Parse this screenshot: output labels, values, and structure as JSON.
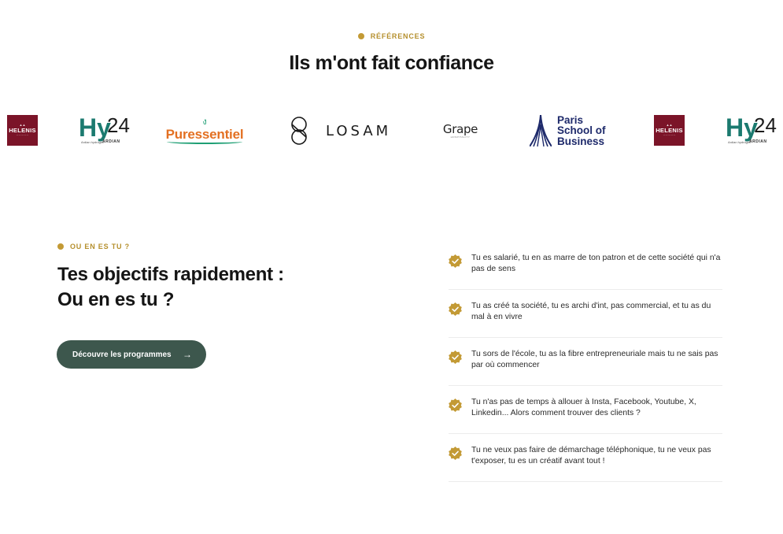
{
  "references": {
    "eyebrow": "RÉFÉRENCES",
    "title": "Ils m'ont fait confiance"
  },
  "logos": {
    "helenis": {
      "name": "HELENIS"
    },
    "hy24": {
      "main": "Hy",
      "number": "24",
      "ardian": "ARDIAN",
      "sub": "Ardian hydrogen"
    },
    "puressentiel": {
      "name": "Puressentiel"
    },
    "losam": {
      "name": "LOSAM"
    },
    "grape": {
      "name": "Grape",
      "tagline": "HOSPITALITY"
    },
    "psb": {
      "line1": "Paris",
      "line2": "School of",
      "line3": "Business"
    }
  },
  "objectives": {
    "eyebrow": "OU EN ES TU ?",
    "title_line1": "Tes objectifs rapidement :",
    "title_line2": "Ou en es tu ?",
    "cta_label": "Découvre les programmes",
    "cta_icon": "arrow-right-icon",
    "items": [
      "Tu es salarié, tu en as marre de ton patron et de cette société qui n'a pas de sens",
      "Tu as créé ta société, tu es archi d'int, pas commercial, et tu as du mal à en vivre",
      "Tu sors de l'école, tu as la fibre entrepreneuriale mais tu ne sais pas par où commencer",
      "Tu n'as pas de temps à allouer à Insta, Facebook, Youtube, X, Linkedin... Alors comment trouver des clients ?",
      "Tu ne veux pas faire de démarchage téléphonique, tu ne veux pas t'exposer, tu es un créatif avant tout !"
    ]
  },
  "colors": {
    "accent_gold": "#c39a35",
    "button_green": "#3d574d",
    "helenis_red": "#7b1428"
  }
}
